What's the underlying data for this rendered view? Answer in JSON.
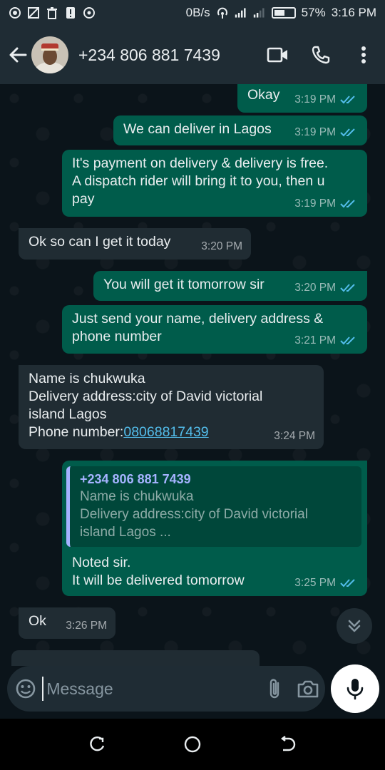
{
  "status_bar": {
    "network_speed": "0B/s",
    "battery_percent": "57%",
    "battery_level": 0.57,
    "time": "3:16 PM",
    "left_icons": [
      "whatsapp-notification-icon",
      "screenshot-icon",
      "trash-icon",
      "alert-icon",
      "circle-icon"
    ]
  },
  "header": {
    "contact_name": "+234 806 881 7439",
    "icons": [
      "back-arrow-icon",
      "video-call-icon",
      "phone-call-icon",
      "more-options-icon"
    ]
  },
  "messages": [
    {
      "dir": "out",
      "text": "Okay",
      "time": "3:19 PM",
      "read": true
    },
    {
      "dir": "out",
      "text": "We can deliver in Lagos",
      "time": "3:19 PM",
      "read": true
    },
    {
      "dir": "out",
      "text": "It's payment on delivery & delivery is free.\nA dispatch rider will bring it to you, then u\npay",
      "time": "3:19 PM",
      "read": true
    },
    {
      "dir": "in",
      "text": "Ok so can I get it today",
      "time": "3:20 PM"
    },
    {
      "dir": "out",
      "text": "You will get it tomorrow sir",
      "time": "3:20 PM",
      "read": true
    },
    {
      "dir": "out",
      "text": "Just send your name, delivery address &\nphone number",
      "time": "3:21 PM",
      "read": true
    },
    {
      "dir": "in",
      "text": "Name is chukwuka\nDelivery address:city of David victorial\nisland Lagos\nPhone number:",
      "link": "08068817439",
      "time": "3:24 PM"
    },
    {
      "dir": "out",
      "quote_author": "+234 806 881 7439",
      "quote_text": "Name is chukwuka\nDelivery address:city of David victorial\nisland Lagos ...",
      "text": "Noted sir.\nIt will be delivered tomorrow",
      "time": "3:25 PM",
      "read": true
    },
    {
      "dir": "in",
      "text": "Ok",
      "time": "3:26 PM"
    }
  ],
  "composer": {
    "placeholder": "Message",
    "icons": [
      "emoji-icon",
      "attach-icon",
      "camera-icon",
      "mic-icon"
    ]
  },
  "colors": {
    "outgoing_bubble": "#005c4b",
    "incoming_bubble": "#202c33",
    "read_ticks": "#53bdeb",
    "background": "#0b141a"
  }
}
